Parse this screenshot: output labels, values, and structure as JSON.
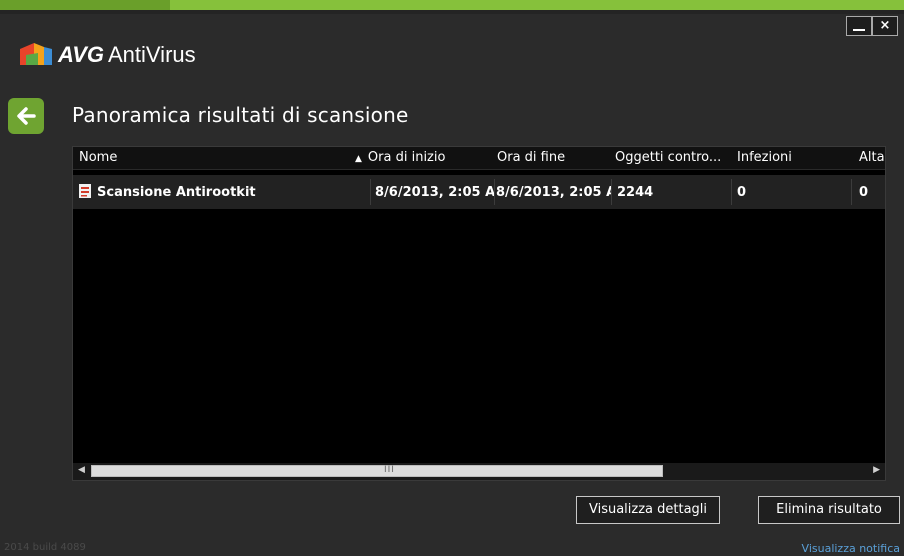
{
  "window": {
    "minimize_label": "_",
    "close_label": "×"
  },
  "app": {
    "brand": "AVG",
    "product": "AntiVirus"
  },
  "page": {
    "title": "Panoramica risultati di scansione"
  },
  "table": {
    "columns": [
      {
        "label": "Nome"
      },
      {
        "label": "Ora di inizio",
        "sorted": "ascending"
      },
      {
        "label": "Ora di fine"
      },
      {
        "label": "Oggetti contro..."
      },
      {
        "label": "Infezioni"
      },
      {
        "label": "Alta"
      }
    ],
    "rows": [
      {
        "name": "Scansione Antirootkit",
        "start": "8/6/2013, 2:05 A",
        "end": "8/6/2013, 2:05 A",
        "objects": "2244",
        "infections": "0",
        "high": "0",
        "icon": "scan-report-icon"
      }
    ],
    "scroll_grip": "III"
  },
  "buttons": {
    "details": "Visualizza dettagli",
    "delete": "Elimina risultato"
  },
  "footer": {
    "build": "2014  build 4089",
    "notify": "Visualizza notifica"
  },
  "colors": {
    "accent_green": "#86c13b",
    "back_button": "#6fa431",
    "link": "#5aa0d8"
  }
}
